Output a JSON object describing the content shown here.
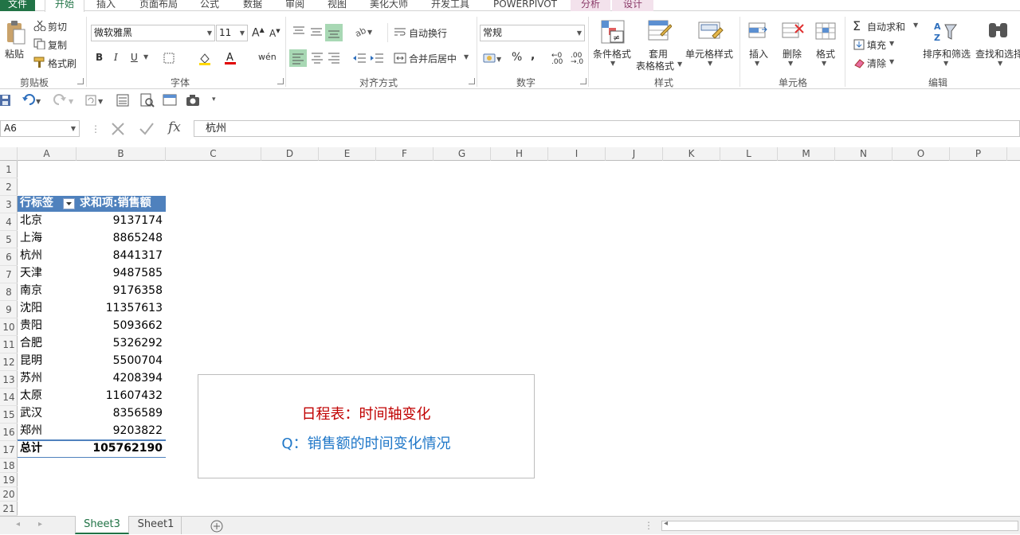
{
  "ribbon_tabs": [
    "文件",
    "开始",
    "插入",
    "页面布局",
    "公式",
    "数据",
    "审阅",
    "视图",
    "美化大师",
    "开发工具",
    "POWERPIVOT",
    "分析",
    "设计"
  ],
  "clipboard": {
    "paste": "粘贴",
    "cut": "剪切",
    "copy": "复制",
    "format_painter": "格式刷",
    "group": "剪贴板"
  },
  "font": {
    "name": "微软雅黑",
    "size": "11",
    "bold": "B",
    "italic": "I",
    "underline": "U",
    "group": "字体"
  },
  "alignment": {
    "wrap": "自动换行",
    "merge": "合并后居中",
    "group": "对齐方式"
  },
  "number": {
    "format": "常规",
    "group": "数字"
  },
  "styles": {
    "conditional": "条件格式",
    "table_1": "套用",
    "table_2": "表格格式",
    "cell_styles": "单元格样式",
    "group": "样式"
  },
  "cells": {
    "insert": "插入",
    "delete": "删除",
    "format": "格式",
    "group": "单元格"
  },
  "editing": {
    "autosum": "自动求和",
    "fill": "填充",
    "clear": "清除",
    "sort": "排序和筛选",
    "find": "查找和选择",
    "group": "编辑"
  },
  "formula_bar": {
    "name_box": "A6",
    "fx": "fx",
    "value": "杭州"
  },
  "columns": [
    "A",
    "B",
    "C",
    "D",
    "E",
    "F",
    "G",
    "H",
    "I",
    "J",
    "K",
    "L",
    "M",
    "N",
    "O",
    "P"
  ],
  "rows": [
    "1",
    "2",
    "3",
    "4",
    "5",
    "6",
    "7",
    "8",
    "9",
    "10",
    "11",
    "12",
    "13",
    "14",
    "15",
    "16",
    "17",
    "18",
    "19",
    "20",
    "21"
  ],
  "pivot": {
    "header_label": "行标签",
    "header_value": "求和项:销售额",
    "rows": [
      {
        "city": "北京",
        "value": "9137174"
      },
      {
        "city": "上海",
        "value": "8865248"
      },
      {
        "city": "杭州",
        "value": "8441317"
      },
      {
        "city": "天津",
        "value": "9487585"
      },
      {
        "city": "南京",
        "value": "9176358"
      },
      {
        "city": "沈阳",
        "value": "11357613"
      },
      {
        "city": "贵阳",
        "value": "5093662"
      },
      {
        "city": "合肥",
        "value": "5326292"
      },
      {
        "city": "昆明",
        "value": "5500704"
      },
      {
        "city": "苏州",
        "value": "4208394"
      },
      {
        "city": "太原",
        "value": "11607432"
      },
      {
        "city": "武汉",
        "value": "8356589"
      },
      {
        "city": "郑州",
        "value": "9203822"
      }
    ],
    "total_label": "总计",
    "total_value": "105762190"
  },
  "textbox": {
    "line1": "日程表：时间轴变化",
    "line2": "Q：销售额的时间变化情况"
  },
  "sheets": [
    "Sheet3",
    "Sheet1"
  ],
  "colors": {
    "accent": "#217346",
    "pivot_header": "#4f81bd",
    "line1": "#c00000",
    "line2": "#1f77c8"
  }
}
